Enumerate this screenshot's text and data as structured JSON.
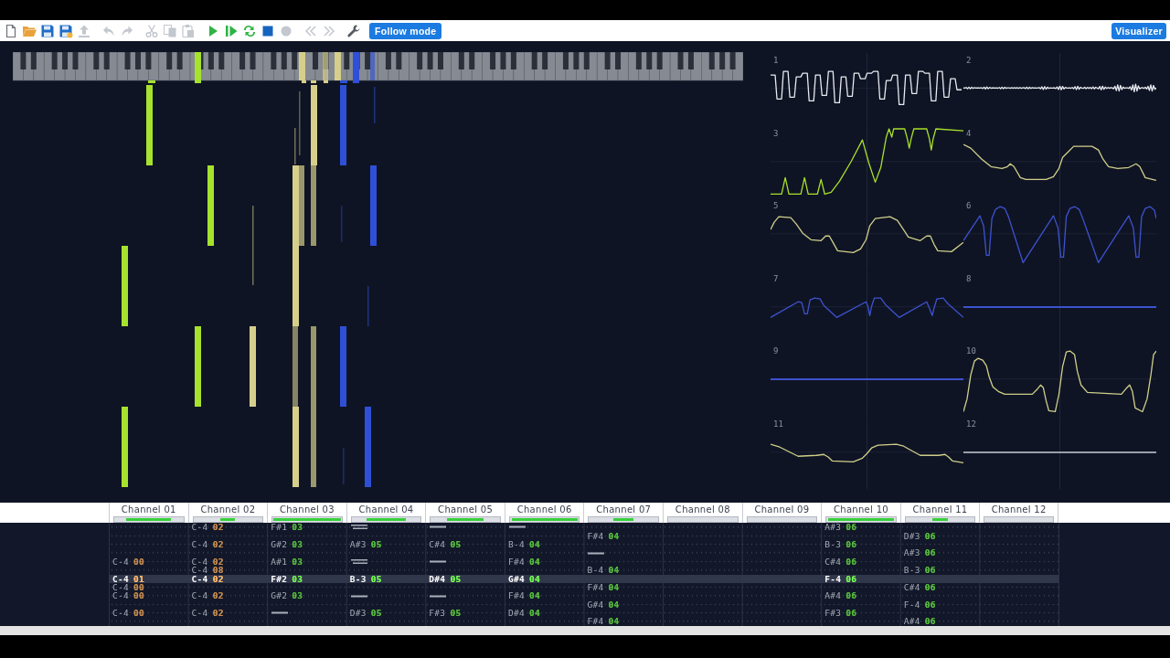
{
  "toolbar": {
    "groups": [
      [
        {
          "disabled": false
        },
        {
          "disabled": false
        },
        {
          "disabled": false
        },
        {
          "disabled": false
        },
        {
          "disabled": true
        }
      ],
      [
        {
          "disabled": true
        },
        {
          "disabled": true
        }
      ],
      [
        {
          "disabled": true
        },
        {
          "disabled": true
        },
        {
          "disabled": true
        }
      ],
      [
        {
          "disabled": false
        },
        {
          "disabled": false
        },
        {
          "disabled": false
        },
        {
          "disabled": false
        },
        {
          "disabled": true
        }
      ],
      [
        {
          "disabled": true
        },
        {
          "disabled": true
        }
      ],
      [
        {
          "disabled": false
        }
      ]
    ],
    "follow_mode_button": {
      "label": "Follow mode"
    },
    "visualizer_button": {
      "label": "Visualizer"
    }
  },
  "scopes": [
    {
      "label": "1",
      "color": "#e8eaf0"
    },
    {
      "label": "2",
      "color": "#e8eaf0"
    },
    {
      "label": "3",
      "color": "#a8e02a"
    },
    {
      "label": "4",
      "color": "#cfcf8a"
    },
    {
      "label": "5",
      "color": "#cfcf8a"
    },
    {
      "label": "6",
      "color": "#3d52cf"
    },
    {
      "label": "7",
      "color": "#3d52cf"
    },
    {
      "label": "8",
      "color": "#3d52cf"
    },
    {
      "label": "9",
      "color": "#3d52cf"
    },
    {
      "label": "10",
      "color": "#cfcf8a"
    },
    {
      "label": "11",
      "color": "#cfcf8a"
    },
    {
      "label": "12",
      "color": "#9a9ea8"
    }
  ],
  "channels": [
    {
      "name": "Channel 01",
      "level": 0.65,
      "color": "#c0874f"
    },
    {
      "name": "Channel 02",
      "level": 0.21,
      "color": "#c0874f"
    },
    {
      "name": "Channel 03",
      "level": 0.97,
      "color": "#55b83c"
    },
    {
      "name": "Channel 04",
      "level": 0.57,
      "color": "#55b83c"
    },
    {
      "name": "Channel 05",
      "level": 0.53,
      "color": "#55b83c"
    },
    {
      "name": "Channel 06",
      "level": 0.95,
      "color": "#55b83c"
    },
    {
      "name": "Channel 07",
      "level": 0.29,
      "color": "#55b83c"
    },
    {
      "name": "Channel 08"
    },
    {
      "name": "Channel 09"
    },
    {
      "name": "Channel 10",
      "level": 0.96,
      "color": "#55b83c"
    },
    {
      "name": "Channel 11",
      "level": 0.23,
      "color": "#55b83c"
    },
    {
      "name": "Channel 12"
    }
  ],
  "pattern": {
    "rows": [
      {
        "selected": false,
        "cells": [
          null,
          {
            "kind": "note",
            "note": "C-4",
            "instrument": "02"
          },
          {
            "kind": "note",
            "note": "F#1",
            "instrument": "03"
          },
          {
            "kind": "release"
          },
          {
            "kind": "off"
          },
          {
            "kind": "off"
          },
          null,
          null,
          null,
          {
            "kind": "note",
            "note": "A#3",
            "instrument": "06"
          },
          null,
          null
        ]
      },
      {
        "selected": false,
        "cells": [
          null,
          null,
          null,
          null,
          null,
          null,
          {
            "kind": "note",
            "note": "F#4",
            "instrument": "04"
          },
          null,
          null,
          null,
          {
            "kind": "note",
            "note": "D#3",
            "instrument": "06"
          },
          null
        ]
      },
      {
        "selected": false,
        "cells": [
          null,
          {
            "kind": "note",
            "note": "C-4",
            "instrument": "02"
          },
          {
            "kind": "note",
            "note": "G#2",
            "instrument": "03"
          },
          {
            "kind": "note",
            "note": "A#3",
            "instrument": "05"
          },
          {
            "kind": "note",
            "note": "C#4",
            "instrument": "05"
          },
          {
            "kind": "note",
            "note": "B-4",
            "instrument": "04"
          },
          null,
          null,
          null,
          {
            "kind": "note",
            "note": "B-3",
            "instrument": "06"
          },
          null,
          null
        ]
      },
      {
        "selected": false,
        "cells": [
          null,
          null,
          null,
          null,
          null,
          null,
          {
            "kind": "off"
          },
          null,
          null,
          null,
          {
            "kind": "note",
            "note": "A#3",
            "instrument": "06"
          },
          null
        ]
      },
      {
        "selected": false,
        "cells": [
          {
            "kind": "note",
            "note": "C-4",
            "instrument": "00"
          },
          {
            "kind": "note",
            "note": "C-4",
            "instrument": "02"
          },
          {
            "kind": "note",
            "note": "A#1",
            "instrument": "03"
          },
          {
            "kind": "release"
          },
          {
            "kind": "off"
          },
          {
            "kind": "note",
            "note": "F#4",
            "instrument": "04"
          },
          null,
          null,
          null,
          {
            "kind": "note",
            "note": "C#4",
            "instrument": "06"
          },
          null,
          null
        ]
      },
      {
        "selected": false,
        "cells": [
          null,
          {
            "kind": "note",
            "note": "C-4",
            "instrument": "08"
          },
          null,
          null,
          null,
          null,
          {
            "kind": "note",
            "note": "B-4",
            "instrument": "04"
          },
          null,
          null,
          null,
          {
            "kind": "note",
            "note": "B-3",
            "instrument": "06"
          },
          null
        ]
      },
      {
        "selected": true,
        "cells": [
          {
            "kind": "note",
            "note": "C-4",
            "instrument": "01"
          },
          {
            "kind": "note",
            "note": "C-4",
            "instrument": "02"
          },
          {
            "kind": "note",
            "note": "F#2",
            "instrument": "03"
          },
          {
            "kind": "note",
            "note": "B-3",
            "instrument": "05"
          },
          {
            "kind": "note",
            "note": "D#4",
            "instrument": "05"
          },
          {
            "kind": "note",
            "note": "G#4",
            "instrument": "04"
          },
          null,
          null,
          null,
          {
            "kind": "note",
            "note": "F-4",
            "instrument": "06"
          },
          null,
          null
        ]
      },
      {
        "selected": false,
        "cells": [
          {
            "kind": "note",
            "note": "C-4",
            "instrument": "00"
          },
          null,
          null,
          null,
          null,
          null,
          {
            "kind": "note",
            "note": "F#4",
            "instrument": "04"
          },
          null,
          null,
          null,
          {
            "kind": "note",
            "note": "C#4",
            "instrument": "06"
          },
          null
        ]
      },
      {
        "selected": false,
        "cells": [
          {
            "kind": "note",
            "note": "C-4",
            "instrument": "00"
          },
          {
            "kind": "note",
            "note": "C-4",
            "instrument": "02"
          },
          {
            "kind": "note",
            "note": "G#2",
            "instrument": "03"
          },
          {
            "kind": "off"
          },
          {
            "kind": "off"
          },
          {
            "kind": "note",
            "note": "F#4",
            "instrument": "04"
          },
          null,
          null,
          null,
          {
            "kind": "note",
            "note": "A#4",
            "instrument": "06"
          },
          null,
          null
        ]
      },
      {
        "selected": false,
        "cells": [
          null,
          null,
          null,
          null,
          null,
          null,
          {
            "kind": "note",
            "note": "G#4",
            "instrument": "04"
          },
          null,
          null,
          null,
          {
            "kind": "note",
            "note": "F-4",
            "instrument": "06"
          },
          null
        ]
      },
      {
        "selected": false,
        "cells": [
          {
            "kind": "note",
            "note": "C-4",
            "instrument": "00"
          },
          {
            "kind": "note",
            "note": "C-4",
            "instrument": "02"
          },
          {
            "kind": "off"
          },
          {
            "kind": "note",
            "note": "D#3",
            "instrument": "05"
          },
          {
            "kind": "note",
            "note": "F#3",
            "instrument": "05"
          },
          {
            "kind": "note",
            "note": "D#4",
            "instrument": "04"
          },
          null,
          null,
          null,
          {
            "kind": "note",
            "note": "F#3",
            "instrument": "06"
          },
          null,
          null
        ]
      },
      {
        "selected": false,
        "cells": [
          null,
          null,
          null,
          null,
          null,
          null,
          {
            "kind": "note",
            "note": "F#4",
            "instrument": "04"
          },
          null,
          null,
          null,
          {
            "kind": "note",
            "note": "A#4",
            "instrument": "06"
          },
          null
        ]
      }
    ]
  }
}
